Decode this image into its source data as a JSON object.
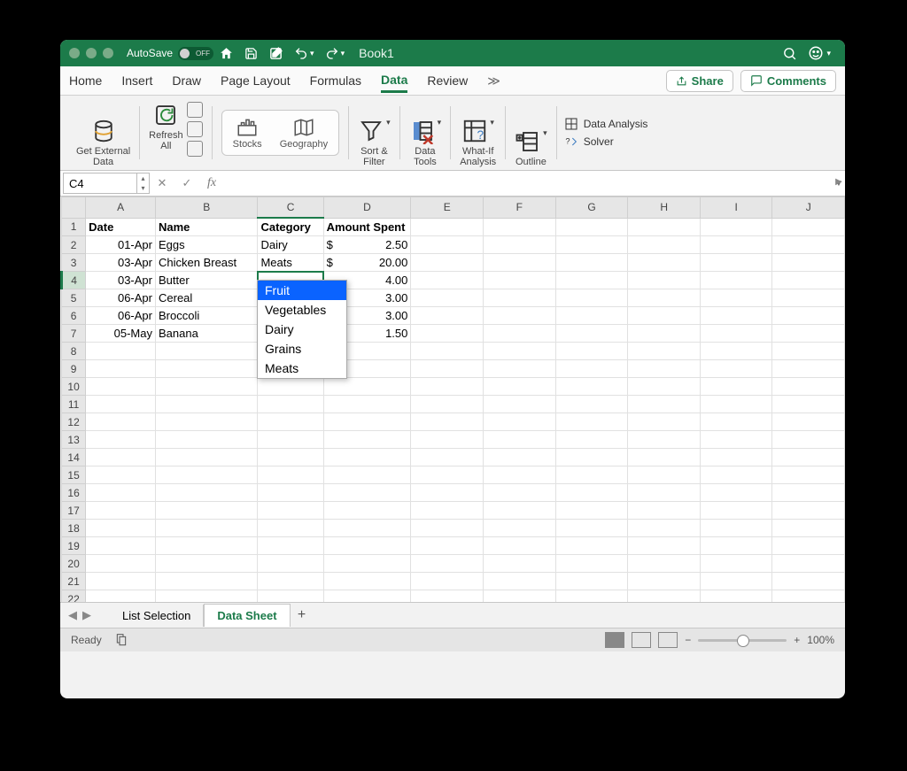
{
  "titlebar": {
    "autosave_label": "AutoSave",
    "autosave_state": "OFF",
    "book_title": "Book1"
  },
  "tabs": {
    "items": [
      "Home",
      "Insert",
      "Draw",
      "Page Layout",
      "Formulas",
      "Data",
      "Review"
    ],
    "active_index": 5,
    "share_label": "Share",
    "comments_label": "Comments"
  },
  "ribbon": {
    "get_external": "Get External\nData",
    "refresh_all": "Refresh\nAll",
    "stocks": "Stocks",
    "geography": "Geography",
    "sort_filter": "Sort &\nFilter",
    "data_tools": "Data\nTools",
    "whatif": "What-If\nAnalysis",
    "outline": "Outline",
    "data_analysis": "Data Analysis",
    "solver": "Solver"
  },
  "formula_bar": {
    "cell_ref": "C4",
    "fx_label": "fx",
    "formula_value": ""
  },
  "grid": {
    "columns": [
      "A",
      "B",
      "C",
      "D",
      "E",
      "F",
      "G",
      "H",
      "I",
      "J"
    ],
    "headers": {
      "A": "Date",
      "B": "Name",
      "C": "Category",
      "D": "Amount Spent"
    },
    "rows": [
      {
        "A": "01-Apr",
        "B": "Eggs",
        "C": "Dairy",
        "D_cur": "$",
        "D_val": "2.50"
      },
      {
        "A": "03-Apr",
        "B": "Chicken Breast",
        "C": "Meats",
        "D_cur": "$",
        "D_val": "20.00"
      },
      {
        "A": "03-Apr",
        "B": "Butter",
        "C": "",
        "D_cur": "",
        "D_val": "4.00"
      },
      {
        "A": "06-Apr",
        "B": "Cereal",
        "C": "",
        "D_cur": "",
        "D_val": "3.00"
      },
      {
        "A": "06-Apr",
        "B": "Broccoli",
        "C": "",
        "D_cur": "",
        "D_val": "3.00"
      },
      {
        "A": "05-May",
        "B": "Banana",
        "C": "",
        "D_cur": "",
        "D_val": "1.50"
      }
    ],
    "visible_row_count": 23,
    "selected_cell": "C4"
  },
  "dropdown": {
    "options": [
      "Fruit",
      "Vegetables",
      "Dairy",
      "Grains",
      "Meats"
    ],
    "highlighted_index": 0
  },
  "sheets": {
    "items": [
      "List Selection",
      "Data Sheet"
    ],
    "active_index": 1
  },
  "status": {
    "ready": "Ready",
    "zoom_label": "100%"
  }
}
